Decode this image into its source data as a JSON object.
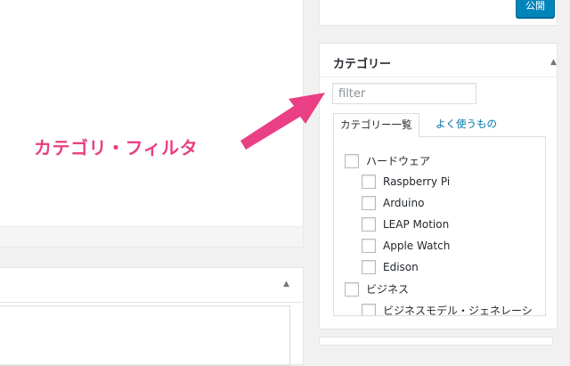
{
  "publish": {
    "button_label": "公開"
  },
  "category_box": {
    "title": "カテゴリー",
    "filter_placeholder": "filter",
    "tabs": [
      {
        "label": "カテゴリー一覧",
        "active": true
      },
      {
        "label": "よく使うもの",
        "active": false
      }
    ],
    "items": [
      {
        "label": "ハードウェア",
        "level": 0,
        "checked": false
      },
      {
        "label": "Raspberry Pi",
        "level": 1,
        "checked": false
      },
      {
        "label": "Arduino",
        "level": 1,
        "checked": false
      },
      {
        "label": "LEAP Motion",
        "level": 1,
        "checked": false
      },
      {
        "label": "Apple Watch",
        "level": 1,
        "checked": false
      },
      {
        "label": "Edison",
        "level": 1,
        "checked": false
      },
      {
        "label": "ビジネス",
        "level": 0,
        "checked": false
      },
      {
        "label": "ビジネスモデル・ジェネレーシ",
        "level": 1,
        "checked": false
      }
    ]
  },
  "annotation": {
    "label": "カテゴリ・フィルタ",
    "color": "#ea3f84"
  },
  "colors": {
    "accent": "#0085ba",
    "link": "#0073aa"
  },
  "icons": {
    "collapse_toggle": "triangle-up-icon"
  }
}
